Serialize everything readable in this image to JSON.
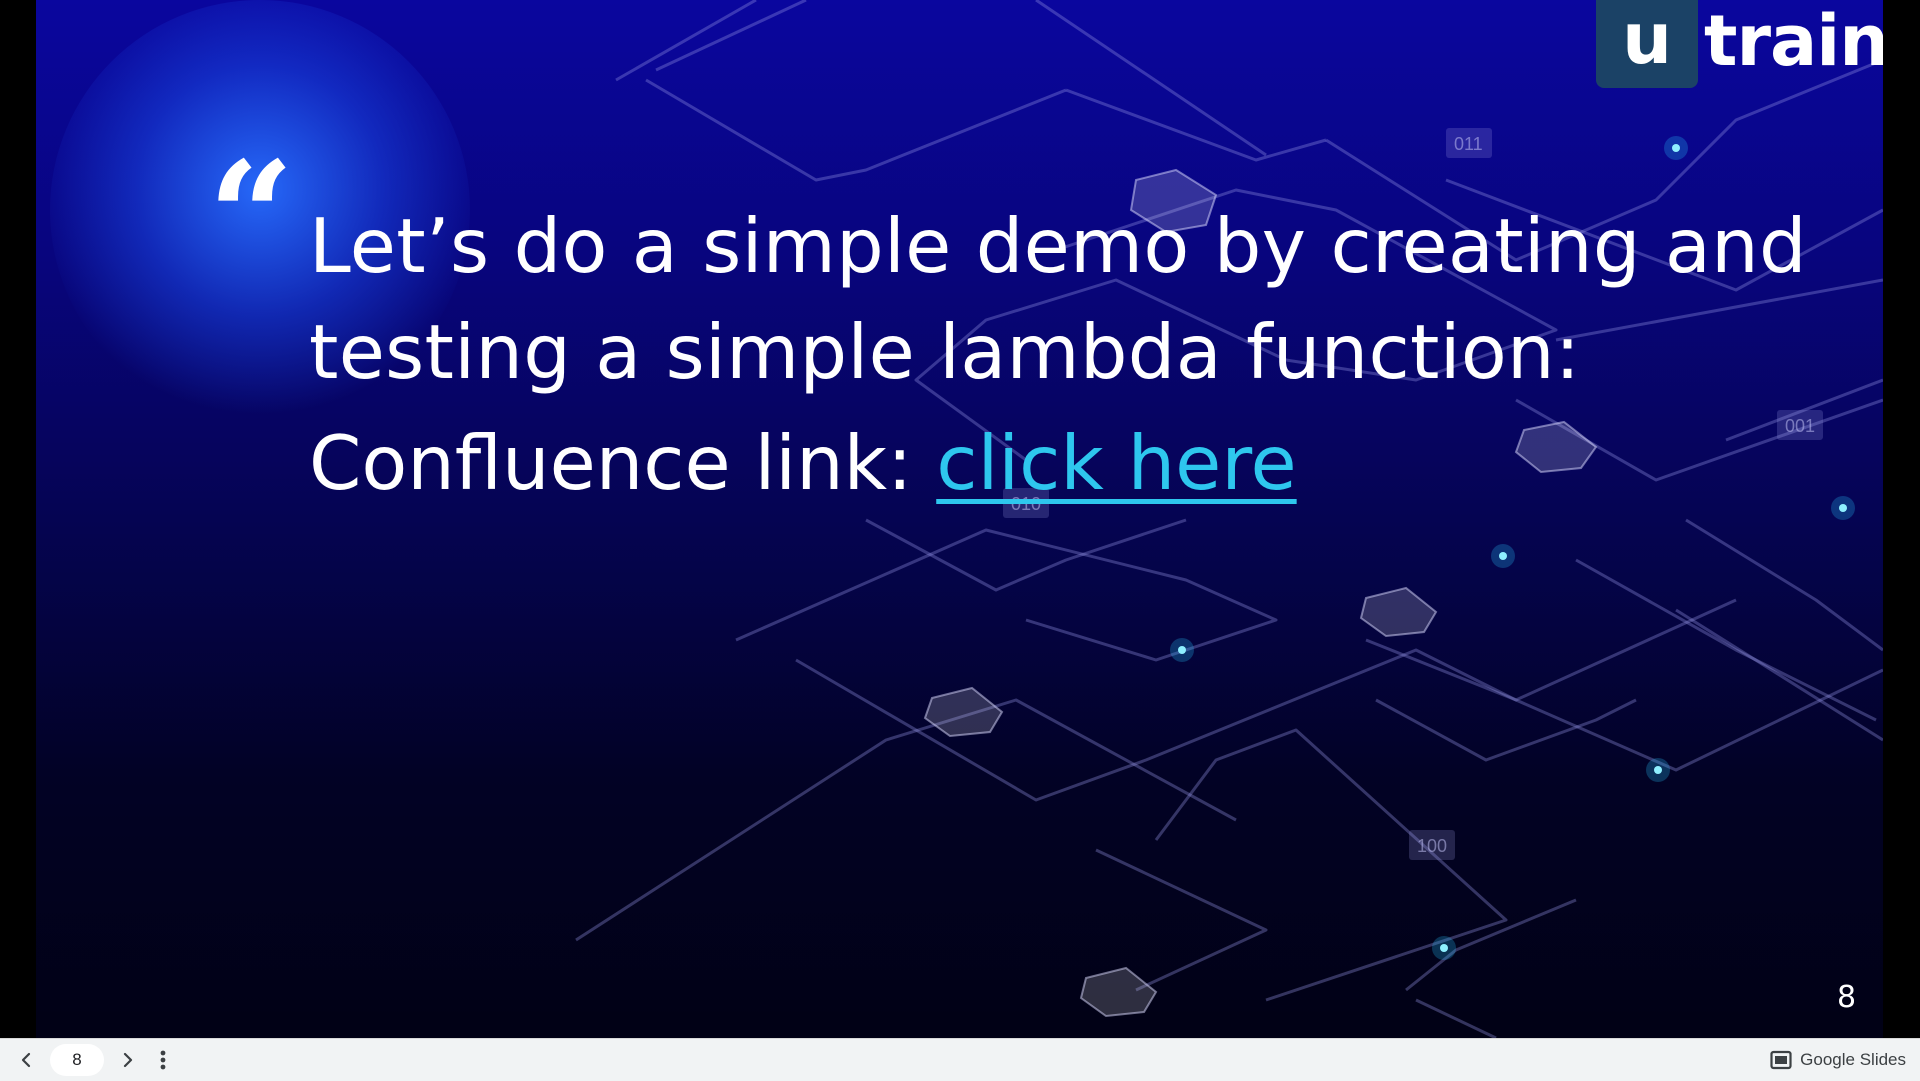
{
  "slide": {
    "logo": {
      "box_letter": "u",
      "text": "train",
      "box_color": "#1b4266"
    },
    "quote_glyph": "“",
    "headline": "Let’s do a simple demo by creating and testing a simple lambda function:",
    "link_prefix": "Confluence link: ",
    "link_text": "click here",
    "link_color": "#2ec7ee",
    "slide_number": "8",
    "binary_labels": [
      "011",
      "001",
      "010",
      "100"
    ],
    "background_colors": [
      "#0a069e",
      "#010115"
    ]
  },
  "toolbar": {
    "prev_icon": "chevron-left-icon",
    "next_icon": "chevron-right-icon",
    "menu_icon": "more-vert-icon",
    "current_page": "8",
    "brand_icon": "google-slides-icon",
    "brand_label": "Google Slides"
  }
}
